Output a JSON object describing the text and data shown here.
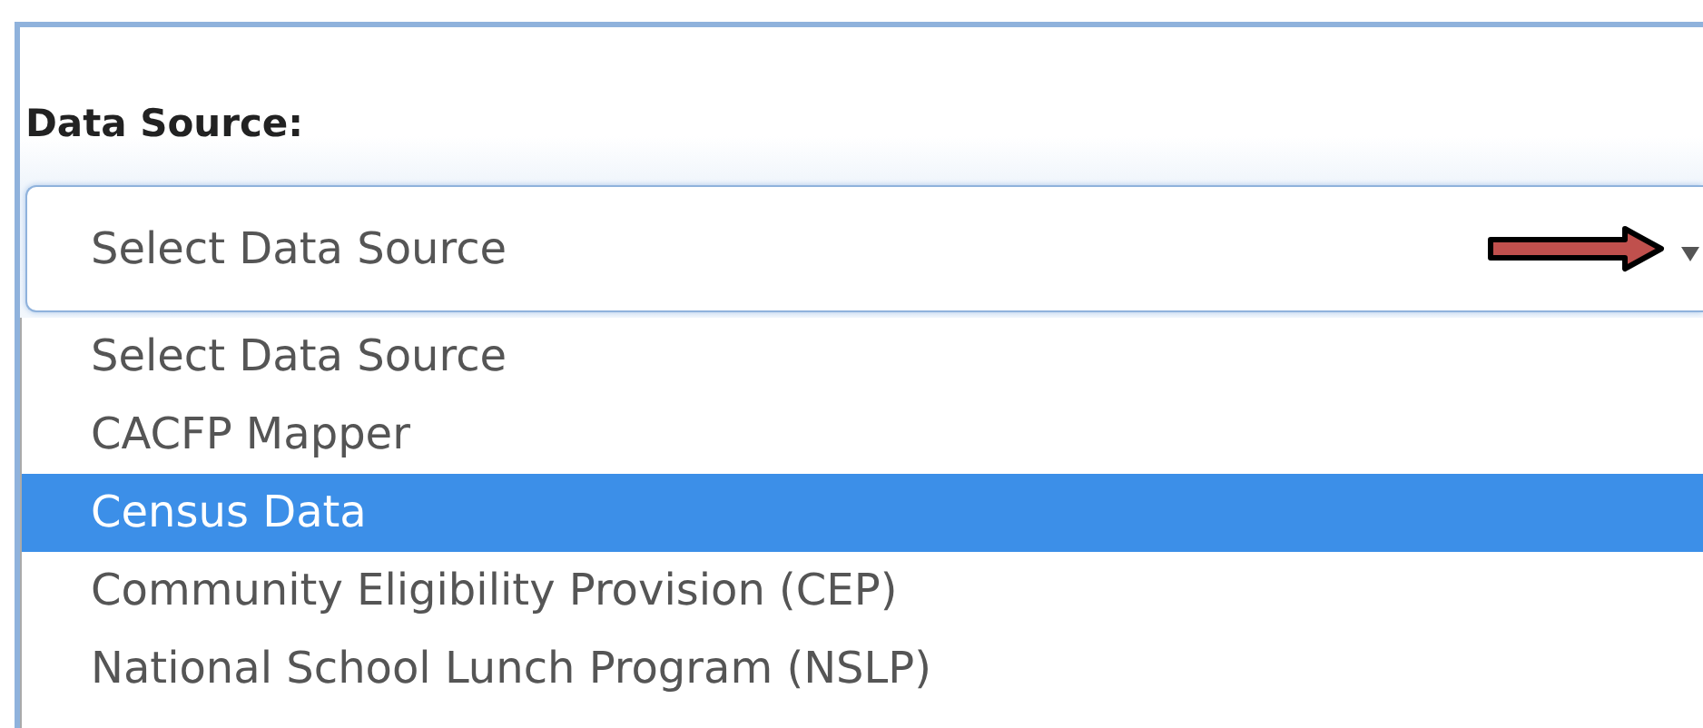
{
  "field": {
    "label": "Data Source:",
    "value": "Select Data Source"
  },
  "options": [
    {
      "label": "Select Data Source",
      "selected": false
    },
    {
      "label": "CACFP Mapper",
      "selected": false
    },
    {
      "label": "Census Data",
      "selected": true
    },
    {
      "label": "Community Eligibility Provision (CEP)",
      "selected": false
    },
    {
      "label": "National School Lunch Program (NSLP)",
      "selected": false
    }
  ]
}
